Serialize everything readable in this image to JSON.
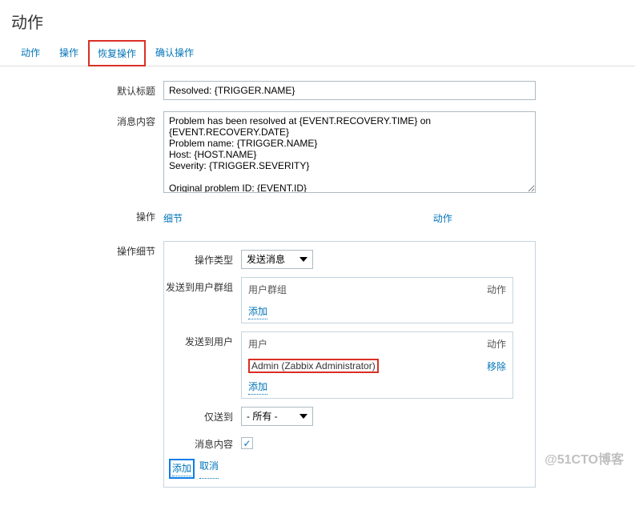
{
  "page_title": "动作",
  "tabs": {
    "t0": "动作",
    "t1": "操作",
    "t2": "恢复操作",
    "t3": "确认操作"
  },
  "form": {
    "default_subject_label": "默认标题",
    "default_subject_value": "Resolved: {TRIGGER.NAME}",
    "message_label": "消息内容",
    "message_value": "Problem has been resolved at {EVENT.RECOVERY.TIME} on {EVENT.RECOVERY.DATE}\nProblem name: {TRIGGER.NAME}\nHost: {HOST.NAME}\nSeverity: {TRIGGER.SEVERITY}\n\nOriginal problem ID: {EVENT.ID}",
    "operations_label": "操作",
    "op_col_details": "细节",
    "op_col_action": "动作",
    "op_details_label": "操作细节"
  },
  "details": {
    "op_type_label": "操作类型",
    "op_type_value": "发送消息",
    "send_groups_label": "发送到用户群组",
    "groups_col1": "用户群组",
    "groups_col2": "动作",
    "groups_add": "添加",
    "send_users_label": "发送到用户",
    "users_col1": "用户",
    "users_col2": "动作",
    "users_row_user": "Admin (Zabbix Administrator)",
    "users_row_action": "移除",
    "users_add": "添加",
    "only_to_label": "仅送到",
    "only_to_value": "- 所有 -",
    "msg_content_label": "消息内容"
  },
  "footer": {
    "add": "添加",
    "cancel": "取消"
  },
  "watermark": "@51CTO博客"
}
